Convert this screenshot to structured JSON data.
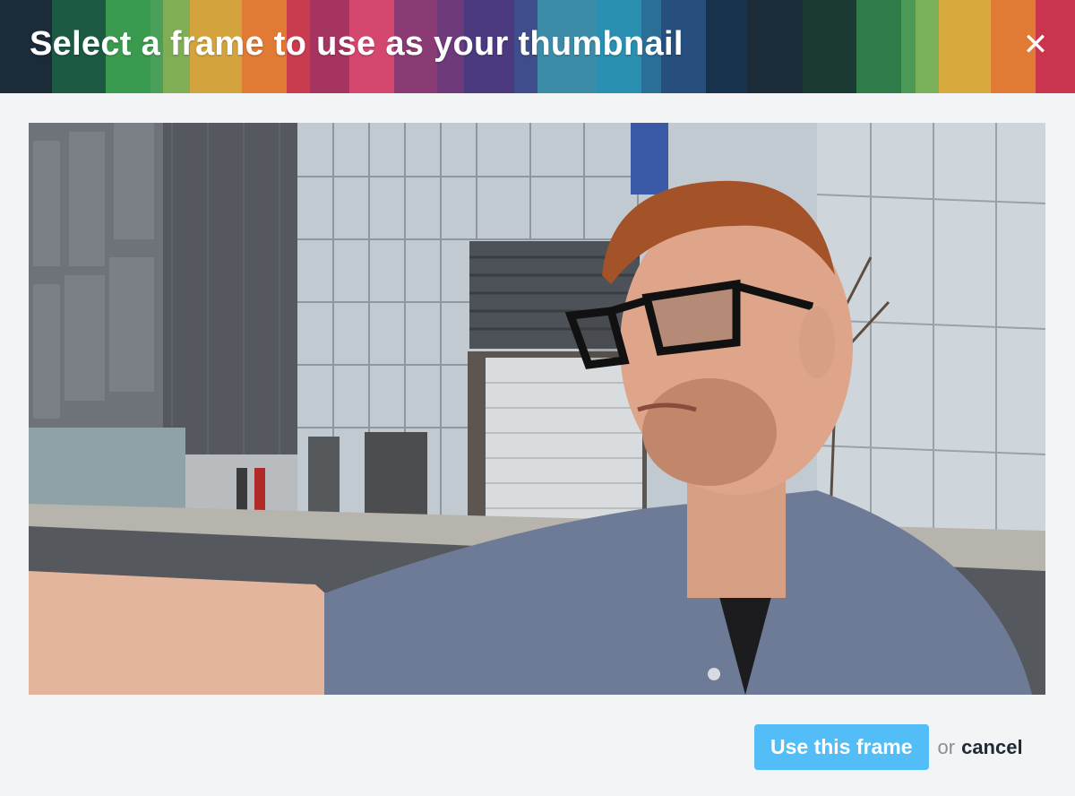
{
  "dialog": {
    "title": "Select a frame to use as your thumbnail",
    "close_icon": "close-icon",
    "header_stripe_colors": [
      "#1b2b38",
      "#1c5a43",
      "#3a9a4f",
      "#7fae55",
      "#d3a43e",
      "#e07a34",
      "#c93b4f",
      "#a63461",
      "#d4476f",
      "#8b3b74",
      "#5c3a7e",
      "#3f4d8c",
      "#3c8ca8",
      "#2a8fb0",
      "#274f7e",
      "#17324d",
      "#1b3a33",
      "#2f7b49",
      "#7ab05a",
      "#d6aa3c",
      "#e07a34",
      "#c9354e"
    ]
  },
  "preview": {
    "image_description_icon": "video-frame-image"
  },
  "actions": {
    "use_frame_label": "Use this frame",
    "or_label": "or",
    "cancel_label": "cancel"
  }
}
